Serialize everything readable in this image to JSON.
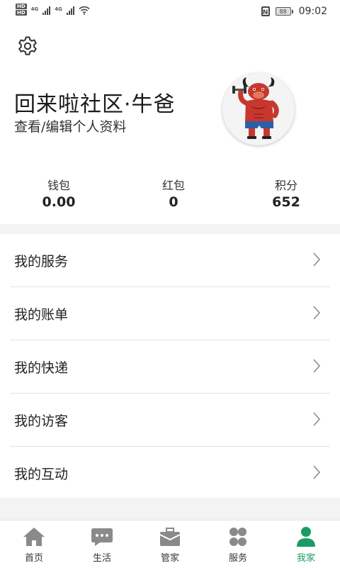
{
  "status_bar": {
    "hd_label": "HD",
    "network_1": "4G",
    "network_2": "4G",
    "battery": "88",
    "time": "09:02"
  },
  "profile": {
    "name": "回来啦社区·牛爸",
    "edit_link": "查看/编辑个人资料"
  },
  "stats": [
    {
      "label": "钱包",
      "value": "0.00"
    },
    {
      "label": "红包",
      "value": "0"
    },
    {
      "label": "积分",
      "value": "652"
    }
  ],
  "menu": [
    {
      "label": "我的服务"
    },
    {
      "label": "我的账单"
    },
    {
      "label": "我的快递"
    },
    {
      "label": "我的访客"
    },
    {
      "label": "我的互动"
    }
  ],
  "bottom_nav": [
    {
      "label": "首页",
      "icon": "home-icon"
    },
    {
      "label": "生活",
      "icon": "chat-icon"
    },
    {
      "label": "管家",
      "icon": "briefcase-icon"
    },
    {
      "label": "服务",
      "icon": "grid-icon"
    },
    {
      "label": "我家",
      "icon": "user-icon",
      "active": true
    }
  ],
  "colors": {
    "accent": "#1a9b64",
    "nav_icon": "#8a8a8a",
    "background_band": "#f3f3f3"
  }
}
